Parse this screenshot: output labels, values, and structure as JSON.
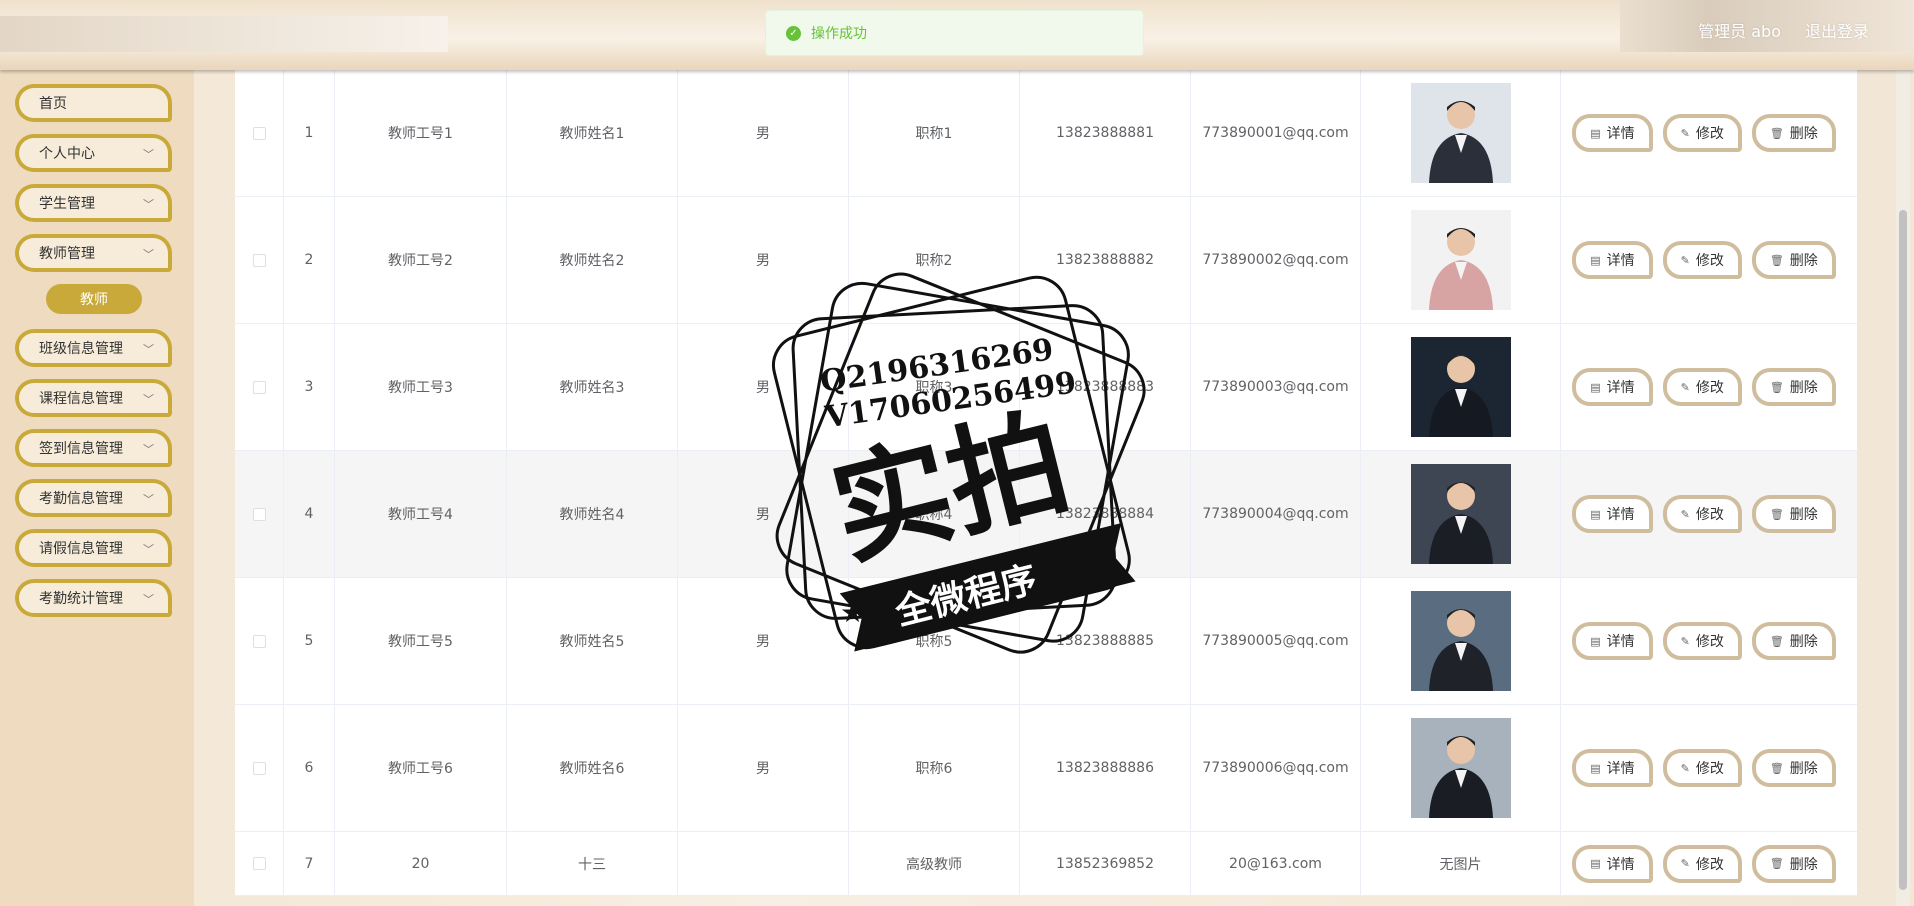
{
  "header": {
    "user_label": "管理员 abo",
    "logout_label": "退出登录"
  },
  "toast": {
    "message": "操作成功",
    "icon": "check-circle-icon"
  },
  "sidebar": {
    "home": "首页",
    "personal_center": "个人中心",
    "student_mgmt": "学生管理",
    "teacher_mgmt": "教师管理",
    "teacher_sub": "教师",
    "class_mgmt": "班级信息管理",
    "course_mgmt": "课程信息管理",
    "signin_mgmt": "签到信息管理",
    "attendance_mgmt": "考勤信息管理",
    "leave_mgmt": "请假信息管理",
    "attendance_stats": "考勤统计管理"
  },
  "actions": {
    "detail": "详情",
    "edit": "修改",
    "delete": "删除"
  },
  "rows": [
    {
      "index": "1",
      "teacher_no": "教师工号1",
      "name": "教师姓名1",
      "gender": "男",
      "title": "职称1",
      "phone": "13823888881",
      "email": "773890001@qq.com",
      "photo": "avatar-man-suit"
    },
    {
      "index": "2",
      "teacher_no": "教师工号2",
      "name": "教师姓名2",
      "gender": "男",
      "title": "职称2",
      "phone": "13823888882",
      "email": "773890002@qq.com",
      "photo": "avatar-woman-pink"
    },
    {
      "index": "3",
      "teacher_no": "教师工号3",
      "name": "教师姓名3",
      "gender": "男",
      "title": "职称3",
      "phone": "13823888883",
      "email": "773890003@qq.com",
      "photo": "avatar-man-dark"
    },
    {
      "index": "4",
      "teacher_no": "教师工号4",
      "name": "教师姓名4",
      "gender": "男",
      "title": "职称4",
      "phone": "13823888884",
      "email": "773890004@qq.com",
      "photo": "avatar-woman-black"
    },
    {
      "index": "5",
      "teacher_no": "教师工号5",
      "name": "教师姓名5",
      "gender": "男",
      "title": "职称5",
      "phone": "13823888885",
      "email": "773890005@qq.com",
      "photo": "avatar-woman-suit"
    },
    {
      "index": "6",
      "teacher_no": "教师工号6",
      "name": "教师姓名6",
      "gender": "男",
      "title": "职称6",
      "phone": "13823888886",
      "email": "773890006@qq.com",
      "photo": "avatar-man-glasses"
    },
    {
      "index": "7",
      "teacher_no": "20",
      "name": "十三",
      "gender": "",
      "title": "高级教师",
      "phone": "13852369852",
      "email": "20@163.com",
      "photo_text": "无图片"
    }
  ],
  "watermark": {
    "line1": "Q2196316269",
    "line2": "V17060256499",
    "big": "实拍",
    "banner": "全微程序"
  },
  "colors": {
    "accent": "#c8a93a",
    "success": "#67c23a"
  }
}
